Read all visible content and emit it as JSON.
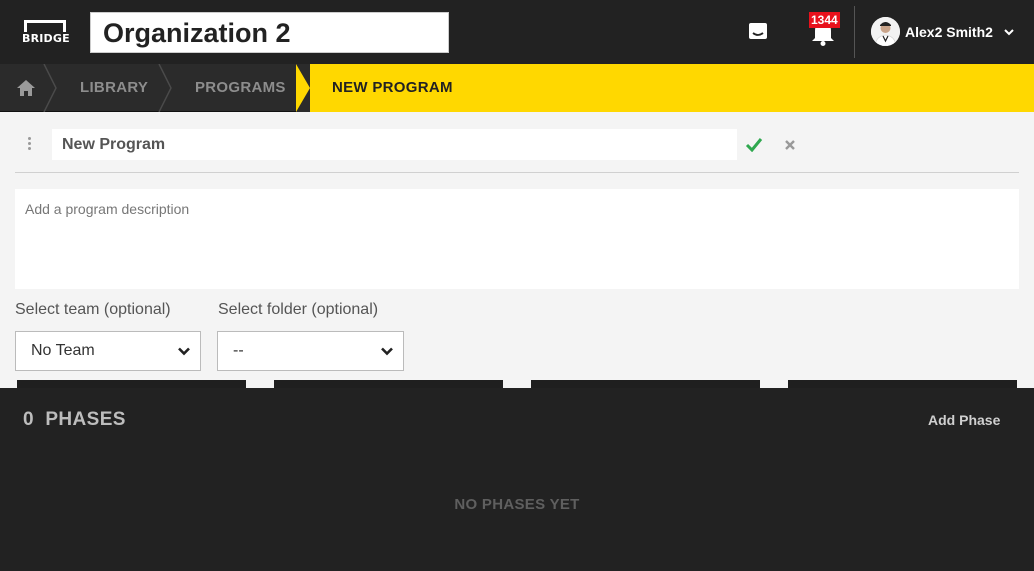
{
  "header": {
    "logo_text": "BRIDGE",
    "organization": "Organization 2",
    "notification_count": "1344",
    "username": "Alex2 Smith2"
  },
  "breadcrumb": {
    "items": [
      "LIBRARY",
      "PROGRAMS"
    ],
    "active": "NEW PROGRAM"
  },
  "program": {
    "title_value": "New Program",
    "description_placeholder": "Add a program description"
  },
  "filters": {
    "team_label": "Select team (optional)",
    "team_value": "No Team",
    "folder_label": "Select folder (optional)",
    "folder_value": "--"
  },
  "phases": {
    "count": "0",
    "heading": "PHASES",
    "add_label": "Add Phase",
    "empty_text": "NO PHASES YET"
  },
  "colors": {
    "accent": "#ffd800",
    "topbar": "#222222",
    "check": "#2fa84f",
    "badge": "#e8111c"
  }
}
